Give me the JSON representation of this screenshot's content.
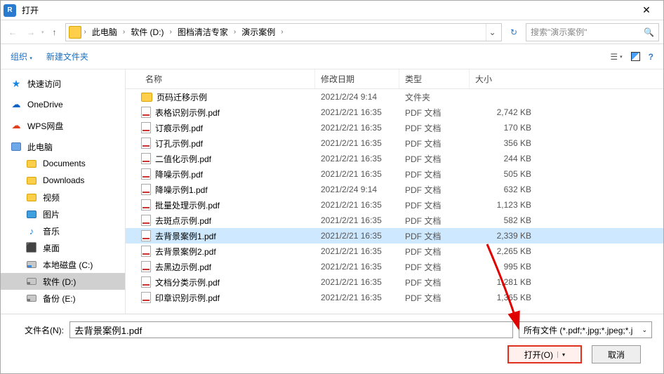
{
  "title": "打开",
  "nav": {
    "breadcrumb": [
      "此电脑",
      "软件 (D:)",
      "图档清洁专家",
      "演示案例"
    ],
    "search_placeholder": "搜索\"演示案例\""
  },
  "toolbar": {
    "organize": "组织",
    "new_folder": "新建文件夹"
  },
  "sidebar": {
    "items": [
      {
        "label": "快速访问",
        "icon": "star"
      },
      {
        "label": "OneDrive",
        "icon": "cloud-blue"
      },
      {
        "label": "WPS网盘",
        "icon": "cloud-red"
      },
      {
        "label": "此电脑",
        "icon": "pc"
      },
      {
        "label": "Documents",
        "icon": "folder",
        "child": true
      },
      {
        "label": "Downloads",
        "icon": "folder",
        "child": true
      },
      {
        "label": "视频",
        "icon": "folder",
        "child": true
      },
      {
        "label": "图片",
        "icon": "img",
        "child": true
      },
      {
        "label": "音乐",
        "icon": "music",
        "child": true
      },
      {
        "label": "桌面",
        "icon": "desk",
        "child": true
      },
      {
        "label": "本地磁盘 (C:)",
        "icon": "disk-blue",
        "child": true
      },
      {
        "label": "软件 (D:)",
        "icon": "disk-gray",
        "child": true,
        "selected": true
      },
      {
        "label": "备份 (E:)",
        "icon": "disk-gray",
        "child": true
      }
    ]
  },
  "columns": {
    "name": "名称",
    "date": "修改日期",
    "type": "类型",
    "size": "大小"
  },
  "files": [
    {
      "name": "页码迁移示例",
      "date": "2021/2/24 9:14",
      "type": "文件夹",
      "size": "",
      "kind": "folder"
    },
    {
      "name": "表格识别示例.pdf",
      "date": "2021/2/21 16:35",
      "type": "PDF 文档",
      "size": "2,742 KB",
      "kind": "pdf"
    },
    {
      "name": "订痕示例.pdf",
      "date": "2021/2/21 16:35",
      "type": "PDF 文档",
      "size": "170 KB",
      "kind": "pdf"
    },
    {
      "name": "订孔示例.pdf",
      "date": "2021/2/21 16:35",
      "type": "PDF 文档",
      "size": "356 KB",
      "kind": "pdf"
    },
    {
      "name": "二值化示例.pdf",
      "date": "2021/2/21 16:35",
      "type": "PDF 文档",
      "size": "244 KB",
      "kind": "pdf"
    },
    {
      "name": "降噪示例.pdf",
      "date": "2021/2/21 16:35",
      "type": "PDF 文档",
      "size": "505 KB",
      "kind": "pdf"
    },
    {
      "name": "降噪示例1.pdf",
      "date": "2021/2/24 9:14",
      "type": "PDF 文档",
      "size": "632 KB",
      "kind": "pdf"
    },
    {
      "name": "批量处理示例.pdf",
      "date": "2021/2/21 16:35",
      "type": "PDF 文档",
      "size": "1,123 KB",
      "kind": "pdf"
    },
    {
      "name": "去斑点示例.pdf",
      "date": "2021/2/21 16:35",
      "type": "PDF 文档",
      "size": "582 KB",
      "kind": "pdf"
    },
    {
      "name": "去背景案例1.pdf",
      "date": "2021/2/21 16:35",
      "type": "PDF 文档",
      "size": "2,339 KB",
      "kind": "pdf",
      "selected": true
    },
    {
      "name": "去背景案例2.pdf",
      "date": "2021/2/21 16:35",
      "type": "PDF 文档",
      "size": "2,265 KB",
      "kind": "pdf"
    },
    {
      "name": "去黑边示例.pdf",
      "date": "2021/2/21 16:35",
      "type": "PDF 文档",
      "size": "995 KB",
      "kind": "pdf"
    },
    {
      "name": "文档分类示例.pdf",
      "date": "2021/2/21 16:35",
      "type": "PDF 文档",
      "size": "1,281 KB",
      "kind": "pdf"
    },
    {
      "name": "印章识别示例.pdf",
      "date": "2021/2/21 16:35",
      "type": "PDF 文档",
      "size": "1,365 KB",
      "kind": "pdf"
    }
  ],
  "bottom": {
    "filename_label": "文件名(N):",
    "filename_value": "去背景案例1.pdf",
    "filter_text": "所有文件 (*.pdf;*.jpg;*.jpeg;*.j",
    "open_btn": "打开(O)",
    "cancel_btn": "取消"
  }
}
